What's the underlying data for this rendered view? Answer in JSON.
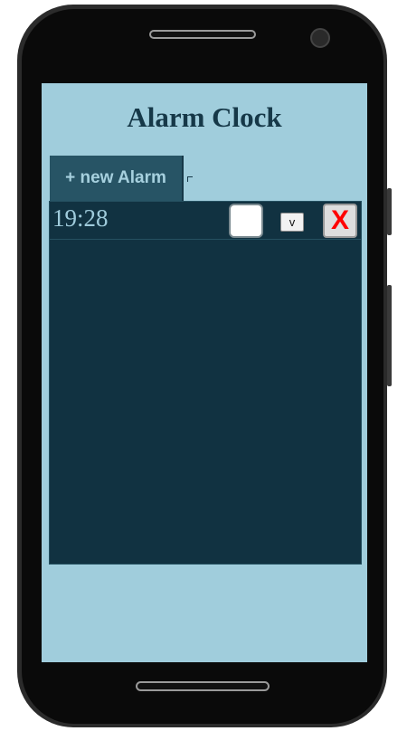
{
  "app": {
    "title": "Alarm Clock",
    "new_alarm_label": "+ new Alarm"
  },
  "alarms": [
    {
      "time": "19:28",
      "enabled": false,
      "toggle_label": "v",
      "delete_label": "X",
      "delete_color": "#ff0000"
    }
  ],
  "colors": {
    "screen_bg": "#a0cddc",
    "panel_bg": "#113241",
    "button_bg": "#275465",
    "title_color": "#163848"
  },
  "icons": {
    "delete": "close-icon",
    "toggle": "chevron-down-icon"
  }
}
